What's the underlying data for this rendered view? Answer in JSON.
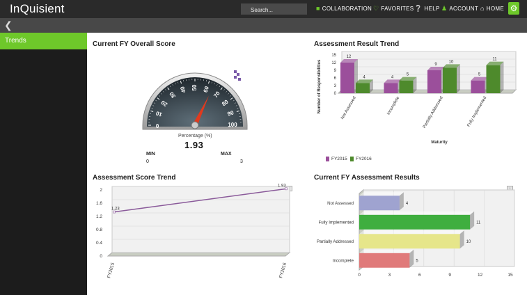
{
  "header": {
    "logo": "InQuisient",
    "search_placeholder": "Search...",
    "nav": [
      {
        "label": "COLLABORATION",
        "icon": "chat-icon"
      },
      {
        "label": "FAVORITES",
        "icon": "heart-icon"
      },
      {
        "label": "HELP",
        "icon": "help-icon"
      },
      {
        "label": "ACCOUNT",
        "icon": "user-icon"
      },
      {
        "label": "HOME",
        "icon": "home-icon"
      }
    ],
    "accent": "#6ec82a"
  },
  "sidebar": {
    "items": [
      {
        "label": "Trends"
      }
    ]
  },
  "panels": {
    "gauge": {
      "title": "Current FY Overall Score",
      "label": "Percentage (%)",
      "value": "1.93",
      "min_label": "MIN",
      "max_label": "MAX",
      "min": "0",
      "max": "3"
    },
    "result_trend": {
      "title": "Assessment Result Trend"
    },
    "score_trend": {
      "title": "Assessment Score Trend"
    },
    "current_results": {
      "title": "Current FY Assessment Results"
    }
  },
  "chart_data": [
    {
      "type": "gauge",
      "ticks": [
        "0",
        "10",
        "20",
        "30",
        "40",
        "50",
        "60",
        "70",
        "80",
        "90",
        "100"
      ],
      "value_percent": 64
    },
    {
      "type": "bar",
      "title": "Assessment Result Trend",
      "xlabel": "Maturity",
      "ylabel": "Number of Responsibilities",
      "categories": [
        "Not Assessed",
        "Incomplete",
        "Partially Addressed",
        "Fully Implemented"
      ],
      "series": [
        {
          "name": "FY2015",
          "values": [
            12,
            4,
            9,
            5
          ],
          "color": "#9b4f9b"
        },
        {
          "name": "FY2016",
          "values": [
            4,
            5,
            10,
            11
          ],
          "color": "#4e8a2c"
        }
      ],
      "ylim": [
        0,
        15
      ],
      "yticks": [
        "0",
        "3",
        "6",
        "9",
        "12",
        "15"
      ]
    },
    {
      "type": "line",
      "title": "Assessment Score Trend",
      "x": [
        "FY2015",
        "FY2016"
      ],
      "values": [
        1.23,
        1.93
      ],
      "labels": [
        "1.23",
        "1.93"
      ],
      "ylim": [
        0,
        2
      ],
      "yticks": [
        "0",
        "0.4",
        "0.8",
        "1.2",
        "1.6",
        "2"
      ],
      "color": "#8a5a9a"
    },
    {
      "type": "bar",
      "orientation": "horizontal",
      "title": "Current FY Assessment Results",
      "categories": [
        "Not Assessed",
        "Fully Implemented",
        "Partially Addressed",
        "Incomplete"
      ],
      "values": [
        4,
        11,
        10,
        5
      ],
      "colors": [
        "#9fa3d0",
        "#3fae3f",
        "#e6e68a",
        "#e07a7a"
      ],
      "xlim": [
        0,
        15
      ],
      "xticks": [
        "0",
        "3",
        "6",
        "9",
        "12",
        "15"
      ]
    }
  ]
}
